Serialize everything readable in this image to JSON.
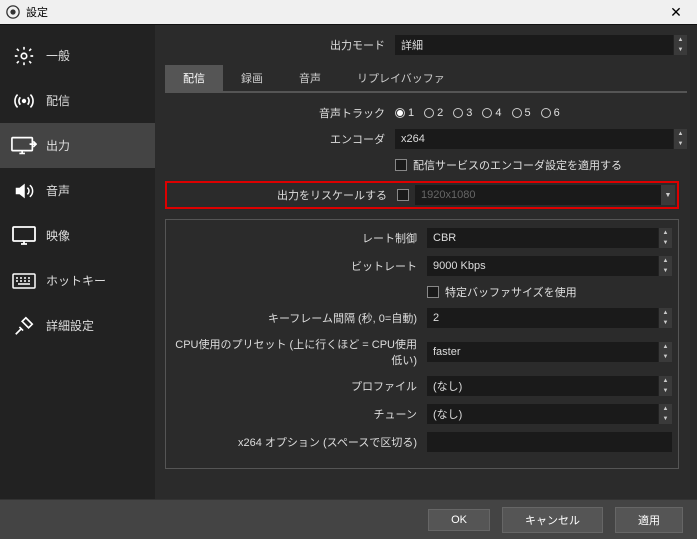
{
  "window": {
    "title": "設定"
  },
  "sidebar": {
    "items": [
      {
        "label": "一般"
      },
      {
        "label": "配信"
      },
      {
        "label": "出力"
      },
      {
        "label": "音声"
      },
      {
        "label": "映像"
      },
      {
        "label": "ホットキー"
      },
      {
        "label": "詳細設定"
      }
    ]
  },
  "top": {
    "output_mode_label": "出力モード",
    "output_mode_value": "詳細"
  },
  "tabs": [
    {
      "label": "配信"
    },
    {
      "label": "録画"
    },
    {
      "label": "音声"
    },
    {
      "label": "リプレイバッファ"
    }
  ],
  "stream": {
    "audio_track_label": "音声トラック",
    "tracks": [
      "1",
      "2",
      "3",
      "4",
      "5",
      "6"
    ],
    "selected_track": "1",
    "encoder_label": "エンコーダ",
    "encoder_value": "x264",
    "enforce_label": "配信サービスのエンコーダ設定を適用する",
    "rescale_label": "出力をリスケールする",
    "rescale_value": "1920x1080"
  },
  "enc": {
    "rate_control_label": "レート制御",
    "rate_control_value": "CBR",
    "bitrate_label": "ビットレート",
    "bitrate_value": "9000 Kbps",
    "custom_buffer_label": "特定バッファサイズを使用",
    "keyint_label": "キーフレーム間隔 (秒, 0=自動)",
    "keyint_value": "2",
    "cpu_preset_label": "CPU使用のプリセット (上に行くほど = CPU使用低い)",
    "cpu_preset_value": "faster",
    "profile_label": "プロファイル",
    "profile_value": "(なし)",
    "tune_label": "チューン",
    "tune_value": "(なし)",
    "x264opts_label": "x264 オプション (スペースで区切る)",
    "x264opts_value": ""
  },
  "footer": {
    "ok": "OK",
    "cancel": "キャンセル",
    "apply": "適用"
  }
}
